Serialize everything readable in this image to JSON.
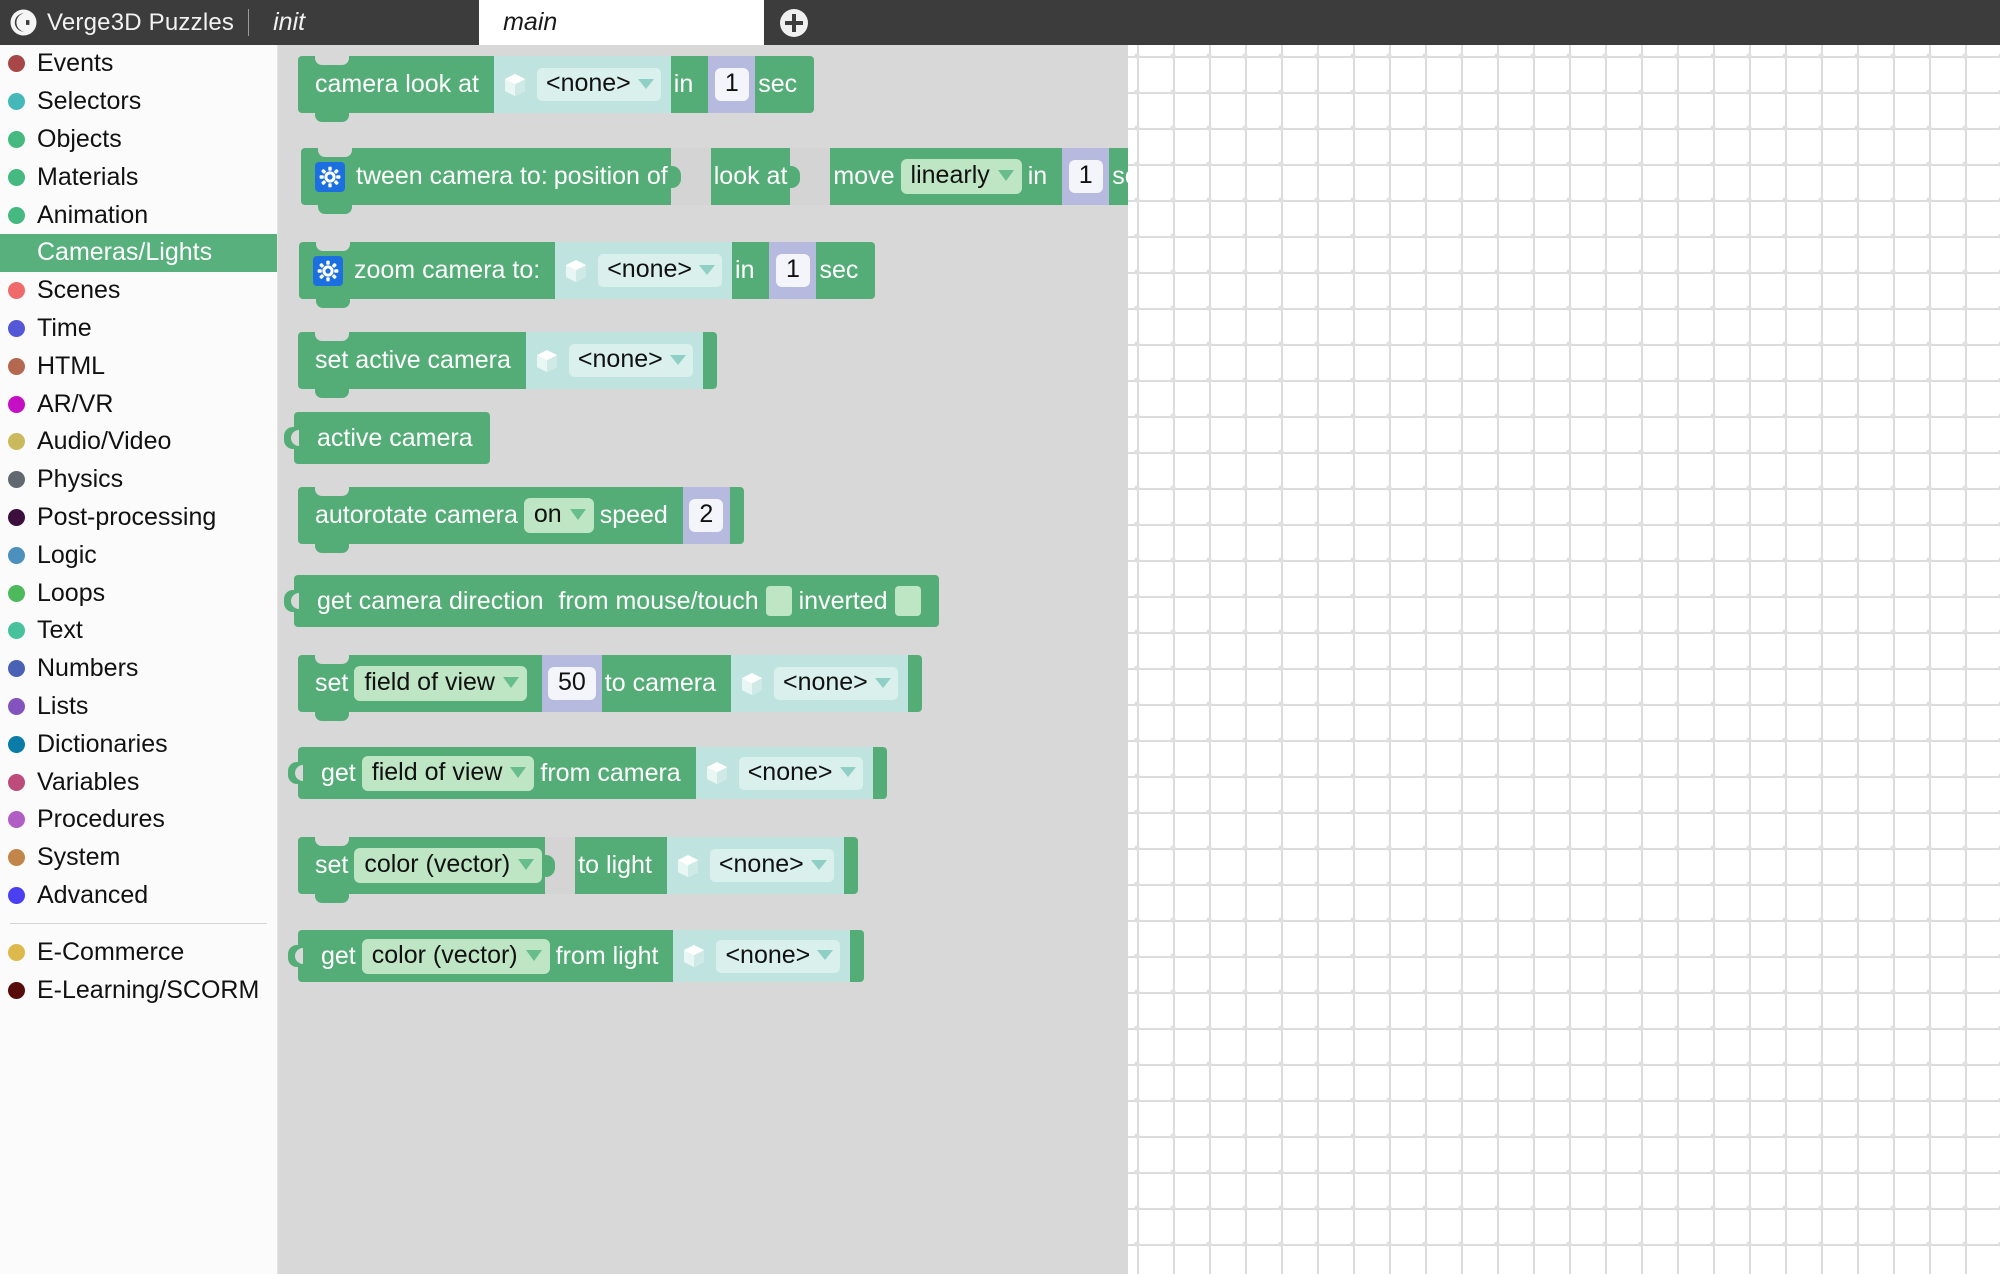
{
  "header": {
    "logo_icon": "verge3d-logo-icon",
    "brand_title": "Verge3D Puzzles",
    "tabs": [
      {
        "label": "init",
        "active": false
      },
      {
        "label": "main",
        "active": true
      }
    ],
    "add_tab_icon": "plus-circle-icon",
    "add_tab_label": "+"
  },
  "sidebar": {
    "categories": [
      {
        "label": "Events",
        "color": "#a84747",
        "selected": false
      },
      {
        "label": "Selectors",
        "color": "#45b9b9",
        "selected": false
      },
      {
        "label": "Objects",
        "color": "#45b97f",
        "selected": false
      },
      {
        "label": "Materials",
        "color": "#45b97f",
        "selected": false
      },
      {
        "label": "Animation",
        "color": "#45b97f",
        "selected": false
      },
      {
        "label": "Cameras/Lights",
        "color": "#58b07d",
        "selected": true
      },
      {
        "label": "Scenes",
        "color": "#ef6b6b",
        "selected": false
      },
      {
        "label": "Time",
        "color": "#5458d6",
        "selected": false
      },
      {
        "label": "HTML",
        "color": "#b4684f",
        "selected": false
      },
      {
        "label": "AR/VR",
        "color": "#c40fc4",
        "selected": false
      },
      {
        "label": "Audio/Video",
        "color": "#cbb95e",
        "selected": false
      },
      {
        "label": "Physics",
        "color": "#61686f",
        "selected": false
      },
      {
        "label": "Post-processing",
        "color": "#3c0f3c",
        "selected": false
      },
      {
        "label": "Logic",
        "color": "#4d90bd",
        "selected": false
      },
      {
        "label": "Loops",
        "color": "#4cb95c",
        "selected": false
      },
      {
        "label": "Text",
        "color": "#47c29b",
        "selected": false
      },
      {
        "label": "Numbers",
        "color": "#4a62b5",
        "selected": false
      },
      {
        "label": "Lists",
        "color": "#8354bd",
        "selected": false
      },
      {
        "label": "Dictionaries",
        "color": "#0b7ba8",
        "selected": false
      },
      {
        "label": "Variables",
        "color": "#bd4b7c",
        "selected": false
      },
      {
        "label": "Procedures",
        "color": "#b05ec4",
        "selected": false
      },
      {
        "label": "System",
        "color": "#c2864b",
        "selected": false
      },
      {
        "label": "Advanced",
        "color": "#4a40f2",
        "selected": false
      }
    ],
    "extra_categories": [
      {
        "label": "E-Commerce",
        "color": "#ddb84b",
        "selected": false
      },
      {
        "label": "E-Learning/SCORM",
        "color": "#570b0b",
        "selected": false
      }
    ]
  },
  "blocks": {
    "camera_look_at": {
      "text1": "camera look at",
      "object_value": "<none>",
      "text2": "in",
      "duration": "1",
      "text3": "sec"
    },
    "tween_camera": {
      "gear_icon": "gear-icon",
      "text1": "tween camera to:",
      "text2": "position of",
      "text3": "look at",
      "text4": "move",
      "easing": "linearly",
      "text5": "in",
      "duration": "1",
      "text6": "sec"
    },
    "zoom_camera": {
      "gear_icon": "gear-icon",
      "text1": "zoom camera to:",
      "object_value": "<none>",
      "text2": "in",
      "duration": "1",
      "text3": "sec"
    },
    "set_active_camera": {
      "text1": "set active camera",
      "object_value": "<none>"
    },
    "active_camera": {
      "text1": "active camera"
    },
    "autorotate_camera": {
      "text1": "autorotate camera",
      "state": "on",
      "text2": "speed",
      "speed": "2"
    },
    "get_camera_direction": {
      "text1": "get camera direction",
      "text2": "from mouse/touch",
      "text3": "inverted"
    },
    "set_field_of_view": {
      "text1": "set",
      "property": "field of view",
      "value": "50",
      "text2": "to camera",
      "object_value": "<none>"
    },
    "get_field_of_view": {
      "text1": "get",
      "property": "field of view",
      "text2": "from camera",
      "object_value": "<none>"
    },
    "set_light_color": {
      "text1": "set",
      "property": "color (vector)",
      "text2": "to light",
      "object_value": "<none>"
    },
    "get_light_color": {
      "text1": "get",
      "property": "color (vector)",
      "text2": "from light",
      "object_value": "<none>"
    }
  },
  "colors": {
    "block_green": "#54ad76",
    "header_dark": "#3c3c3c",
    "flyout_grey": "#d8d8d8",
    "object_field": "#bfe3de",
    "dropdown_green": "#bfe6c4",
    "number_lavender": "#b6bade"
  }
}
